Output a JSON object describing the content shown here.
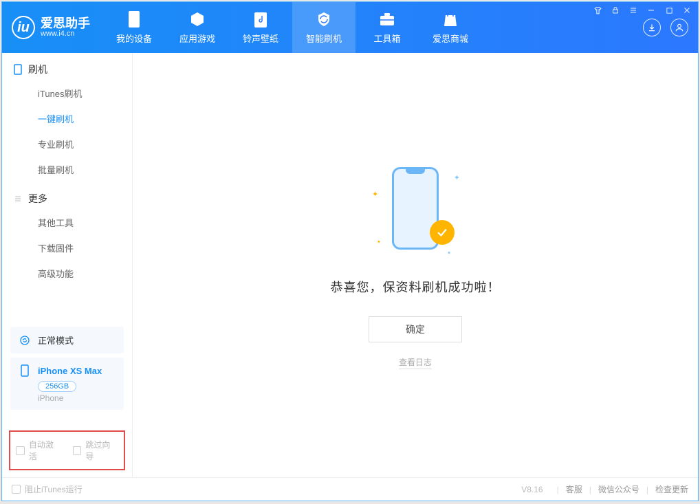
{
  "logo": {
    "name_cn": "爱思助手",
    "url": "www.i4.cn"
  },
  "nav": [
    {
      "label": "我的设备",
      "icon": "device-icon"
    },
    {
      "label": "应用游戏",
      "icon": "app-icon"
    },
    {
      "label": "铃声壁纸",
      "icon": "music-icon"
    },
    {
      "label": "智能刷机",
      "icon": "flash-icon",
      "active": true
    },
    {
      "label": "工具箱",
      "icon": "toolbox-icon"
    },
    {
      "label": "爱思商城",
      "icon": "store-icon"
    }
  ],
  "sidebar": {
    "section1": {
      "title": "刷机",
      "items": [
        "iTunes刷机",
        "一键刷机",
        "专业刷机",
        "批量刷机"
      ],
      "active_index": 1
    },
    "section2": {
      "title": "更多",
      "items": [
        "其他工具",
        "下载固件",
        "高级功能"
      ]
    },
    "mode_card": {
      "label": "正常模式"
    },
    "device_card": {
      "name": "iPhone XS Max",
      "storage": "256GB",
      "type": "iPhone"
    },
    "highlight": {
      "opt1": "自动激活",
      "opt2": "跳过向导"
    }
  },
  "main": {
    "success_title": "恭喜您，保资料刷机成功啦！",
    "ok_button": "确定",
    "view_log": "查看日志"
  },
  "footer": {
    "stop_itunes": "阻止iTunes运行",
    "version": "V8.16",
    "links": [
      "客服",
      "微信公众号",
      "检查更新"
    ]
  }
}
